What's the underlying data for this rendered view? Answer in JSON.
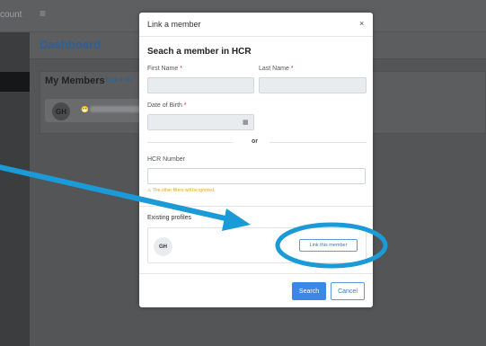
{
  "app": {
    "account_label": "count",
    "menu_icon": "hamburger-icon",
    "dashboard_title": "Dashboard",
    "members_title": "My Members",
    "members_link": "Link a Me",
    "member_initials": "GH",
    "member_emoji": "😷"
  },
  "modal": {
    "title": "Link a member",
    "close_label": "×",
    "section_title": "Seach a member in HCR",
    "first_name_label": "First Name",
    "last_name_label": "Last Name",
    "dob_label": "Date of Birth",
    "required_mark": "*",
    "or_label": "or",
    "hcr_label": "HCR Number",
    "warning": "⚠ The other filters will be ignored.",
    "existing_title": "Existing profiles",
    "profile_initials": "GH",
    "link_button": "Link this member",
    "search_button": "Search",
    "cancel_button": "Cancel",
    "calendar_icon": "calendar-icon"
  },
  "colors": {
    "primary": "#3d87e6",
    "annotation": "#1a9ad6",
    "warning": "#e8a316",
    "required": "#e23"
  }
}
